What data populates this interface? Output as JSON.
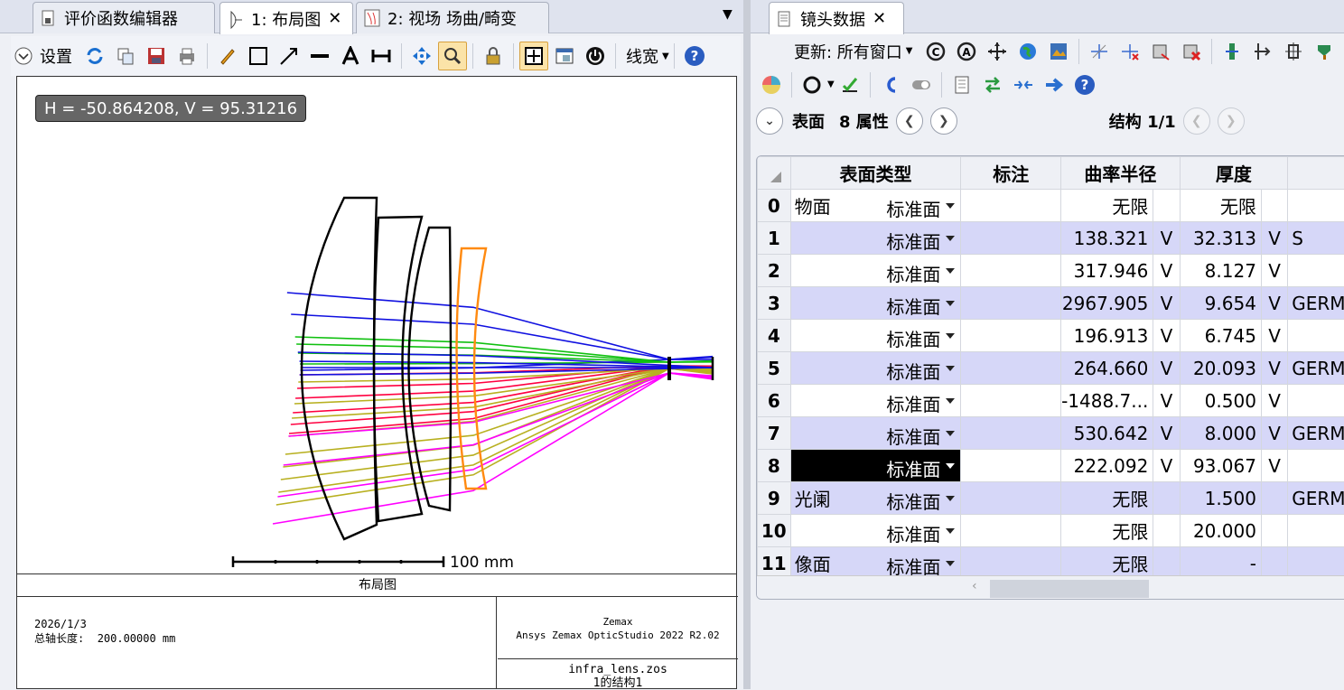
{
  "left_tabs": [
    {
      "label": "评价函数编辑器",
      "icon": "document-icon"
    },
    {
      "label": "1: 布局图",
      "icon": "lens-icon"
    },
    {
      "label": "2: 视场 场曲/畸变",
      "icon": "chart-icon"
    }
  ],
  "left_toolbar": {
    "settings_label": "设置",
    "linewidth_label": "线宽"
  },
  "coord_readout": "H = -50.864208, V = 95.31216",
  "scale_label": "100 mm",
  "footer": {
    "title": "布局图",
    "date": "2026/1/3",
    "axis_length_label": "总轴长度:",
    "axis_length_value": "200.00000 mm",
    "vendor": "Zemax",
    "product": "Ansys Zemax OpticStudio 2022 R2.02",
    "filename": "infra_lens.zos",
    "config": "1的结构1"
  },
  "right_tab": {
    "label": "镜头数据",
    "icon": "document-icon"
  },
  "right_toolbar": {
    "update_label": "更新: 所有窗口"
  },
  "navbar": {
    "surface_label": "表面",
    "props_label": "8 属性",
    "config_label": "结构 1/1"
  },
  "table": {
    "headers": [
      "表面类型",
      "标注",
      "曲率半径",
      "厚度"
    ],
    "rows": [
      {
        "num": "0",
        "name": "物面",
        "type": "标准面",
        "radius": "无限",
        "rflag": "",
        "thick": "无限",
        "tflag": "",
        "mat": ""
      },
      {
        "num": "1",
        "name": "",
        "type": "标准面",
        "radius": "138.321",
        "rflag": "V",
        "thick": "32.313",
        "tflag": "V",
        "mat": "S"
      },
      {
        "num": "2",
        "name": "",
        "type": "标准面",
        "radius": "317.946",
        "rflag": "V",
        "thick": "8.127",
        "tflag": "V",
        "mat": ""
      },
      {
        "num": "3",
        "name": "",
        "type": "标准面",
        "radius": "2967.905",
        "rflag": "V",
        "thick": "9.654",
        "tflag": "V",
        "mat": "GERM"
      },
      {
        "num": "4",
        "name": "",
        "type": "标准面",
        "radius": "196.913",
        "rflag": "V",
        "thick": "6.745",
        "tflag": "V",
        "mat": ""
      },
      {
        "num": "5",
        "name": "",
        "type": "标准面",
        "radius": "264.660",
        "rflag": "V",
        "thick": "20.093",
        "tflag": "V",
        "mat": "GERM"
      },
      {
        "num": "6",
        "name": "",
        "type": "标准面",
        "radius": "-1488.7...",
        "rflag": "V",
        "thick": "0.500",
        "tflag": "V",
        "mat": ""
      },
      {
        "num": "7",
        "name": "",
        "type": "标准面",
        "radius": "530.642",
        "rflag": "V",
        "thick": "8.000",
        "tflag": "V",
        "mat": "GERM"
      },
      {
        "num": "8",
        "name": "",
        "type": "标准面",
        "radius": "222.092",
        "rflag": "V",
        "thick": "93.067",
        "tflag": "V",
        "mat": ""
      },
      {
        "num": "9",
        "name": "光阑",
        "type": "标准面",
        "radius": "无限",
        "rflag": "",
        "thick": "1.500",
        "tflag": "",
        "mat": "GERM"
      },
      {
        "num": "10",
        "name": "",
        "type": "标准面",
        "radius": "无限",
        "rflag": "",
        "thick": "20.000",
        "tflag": "",
        "mat": ""
      },
      {
        "num": "11",
        "name": "像面",
        "type": "标准面",
        "radius": "无限",
        "rflag": "",
        "thick": "-",
        "tflag": "",
        "mat": ""
      }
    ]
  },
  "colors": {
    "alt_row": "#d6d7f8",
    "selected_cell": "#000000",
    "ray_blue": "#1010e0",
    "ray_green": "#10c010",
    "ray_red": "#ff0040",
    "ray_olive": "#b8b020",
    "ray_magenta": "#ff00ff",
    "last_lens": "#ff8a10"
  }
}
